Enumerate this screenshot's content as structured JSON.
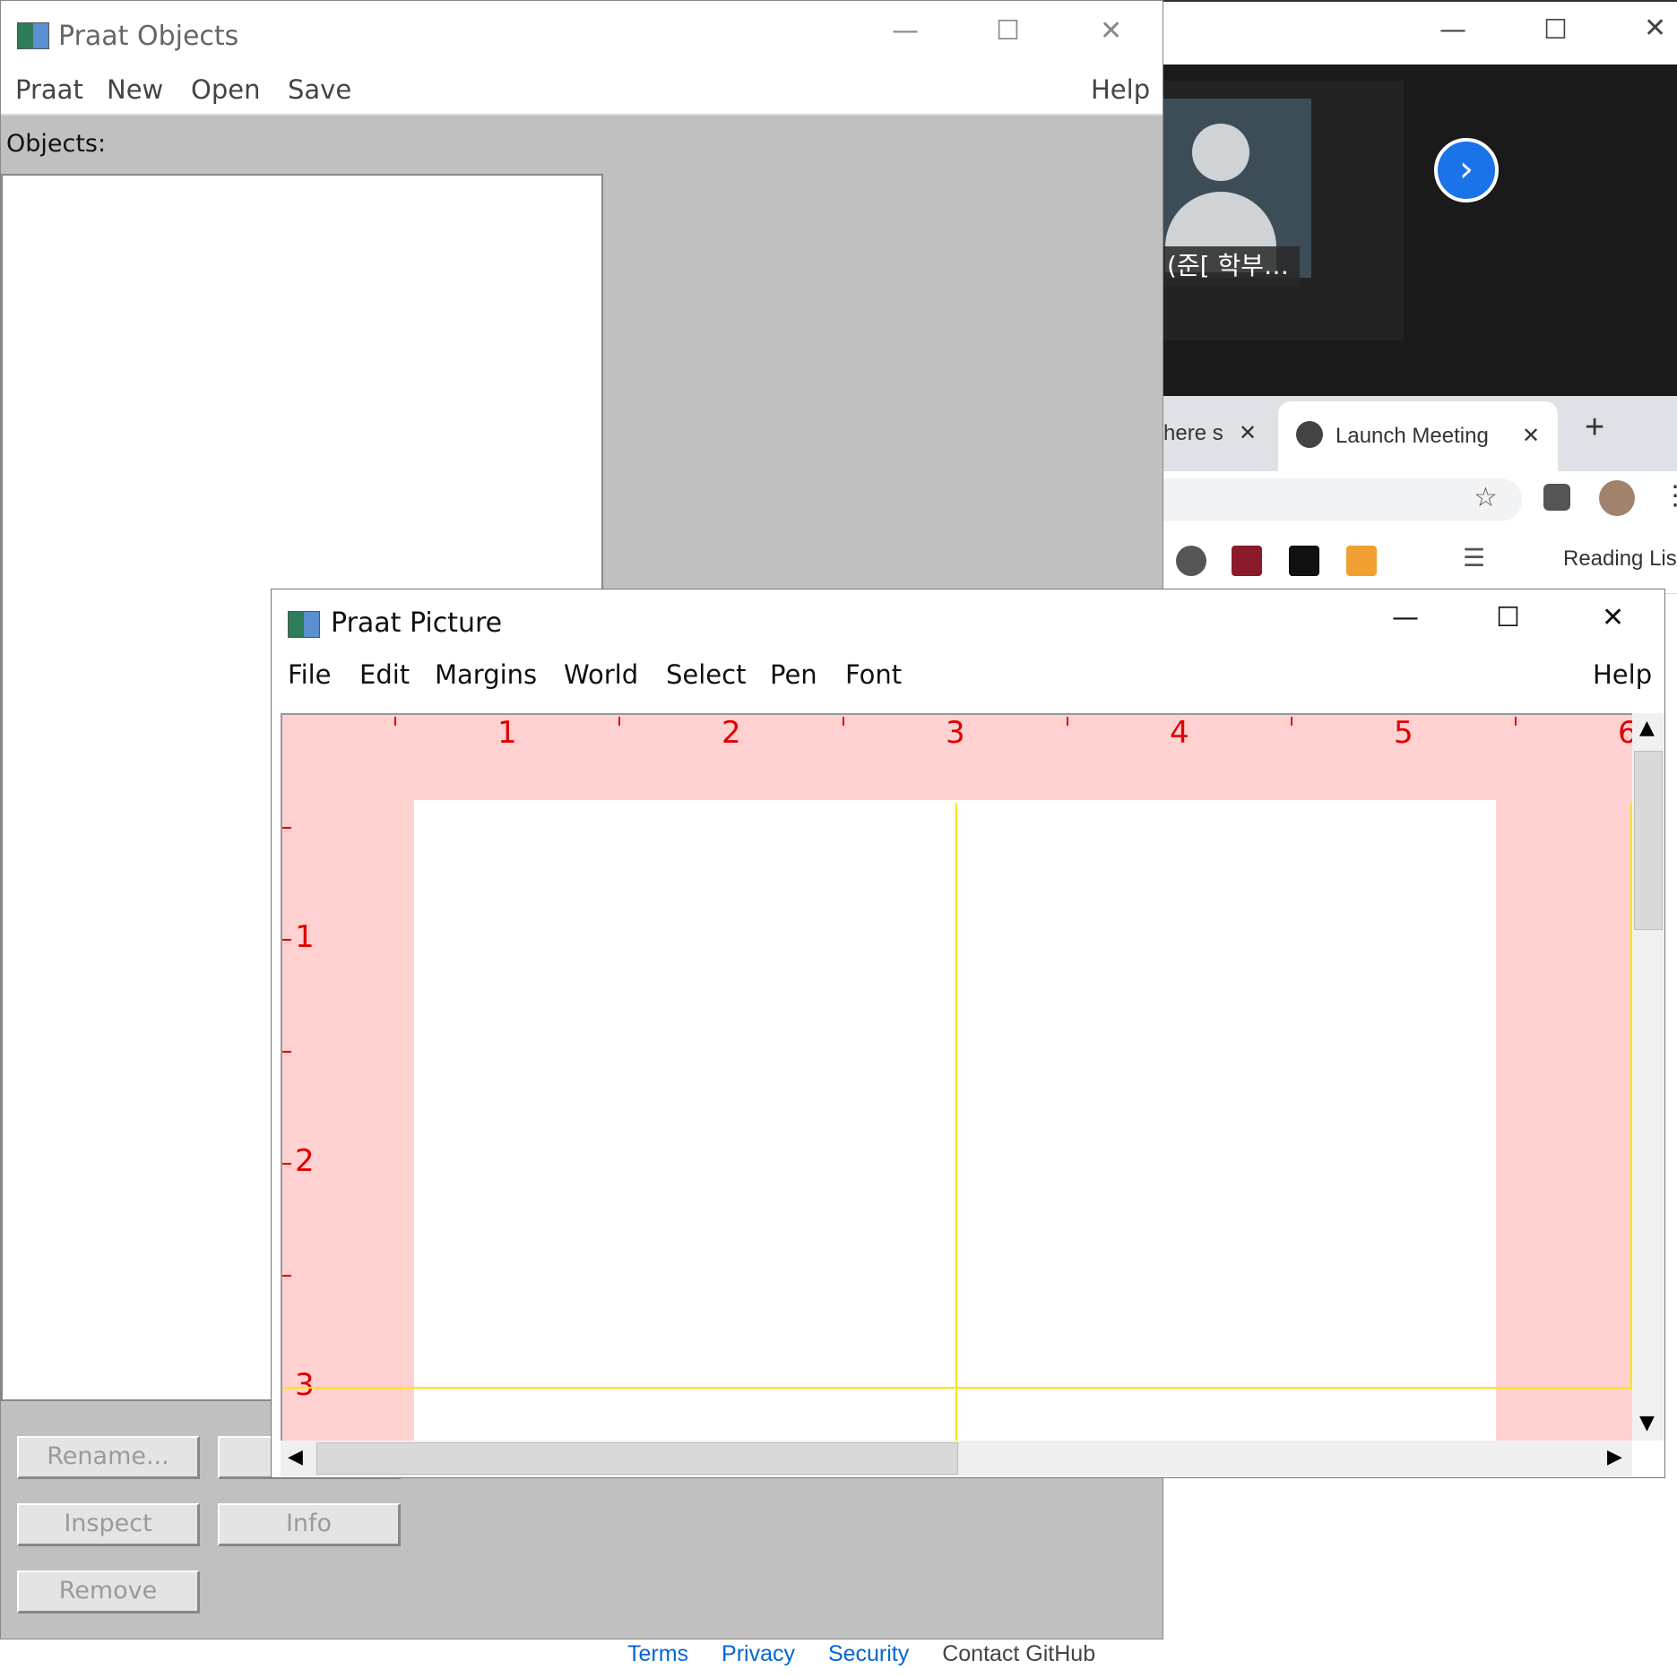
{
  "background_browser": {
    "zoom_participant_name": "(준[ 학부…",
    "tabs": [
      {
        "label": "here s"
      },
      {
        "label": "Launch Meeting"
      }
    ],
    "new_tab_label": "+",
    "reading_list_label": "Reading Lis",
    "footer_links": [
      "Terms",
      "Privacy",
      "Security",
      "Contact GitHub"
    ]
  },
  "objects_window": {
    "title": "Praat Objects",
    "menu": [
      "Praat",
      "New",
      "Open",
      "Save"
    ],
    "help": "Help",
    "objects_label": "Objects:",
    "buttons": {
      "rename": "Rename...",
      "inspect": "Inspect",
      "info": "Info",
      "remove": "Remove"
    }
  },
  "picture_window": {
    "title": "Praat Picture",
    "menu": [
      "File",
      "Edit",
      "Margins",
      "World",
      "Select",
      "Pen",
      "Font"
    ],
    "help": "Help",
    "ruler_x": [
      "1",
      "2",
      "3",
      "4",
      "5",
      "6"
    ],
    "ruler_y": [
      "1",
      "2",
      "3"
    ]
  },
  "colors": {
    "ruler": "#e00000",
    "selection": "#ffe400",
    "canvas_margin": "#ffd1d1"
  },
  "icons": {
    "minimize": "minimize-icon",
    "maximize": "maximize-icon",
    "close": "close-icon"
  }
}
